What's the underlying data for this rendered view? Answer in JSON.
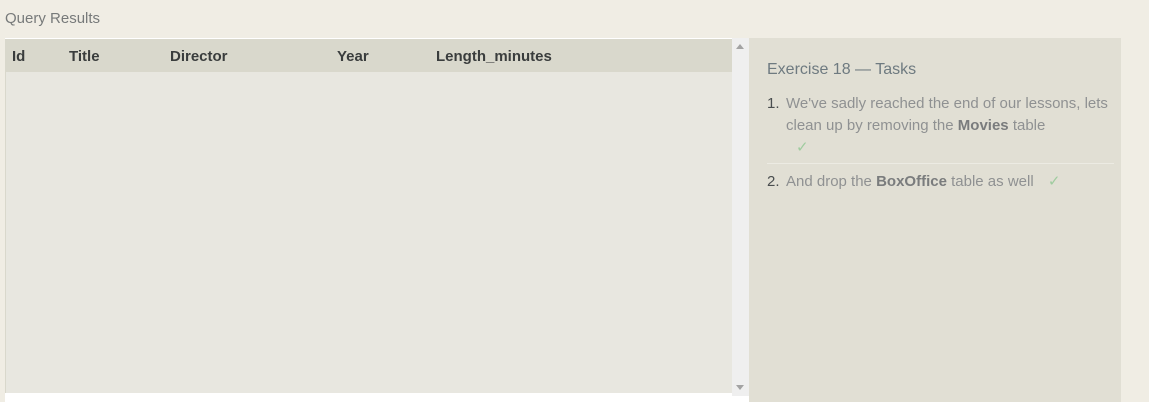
{
  "query_results": {
    "title": "Query Results",
    "columns": [
      "Id",
      "Title",
      "Director",
      "Year",
      "Length_minutes"
    ],
    "rows": []
  },
  "tasks": {
    "title": "Exercise 18 — Tasks",
    "items": [
      {
        "number": "1.",
        "text_before": "We've sadly reached the end of our lessons, lets clean up by removing the",
        "strong": "Movies",
        "text_after": "table",
        "check": "✓"
      },
      {
        "number": "2.",
        "text_before": "And drop the",
        "strong": "BoxOffice",
        "text_after": "table as well",
        "check": "✓"
      }
    ]
  },
  "colors": {
    "page_bg": "#f0ede4",
    "table_bg": "#e8e7e0",
    "header_bg": "#d9d8cc",
    "tasks_bg": "#e1dfd4",
    "check": "#9fcc9f"
  }
}
